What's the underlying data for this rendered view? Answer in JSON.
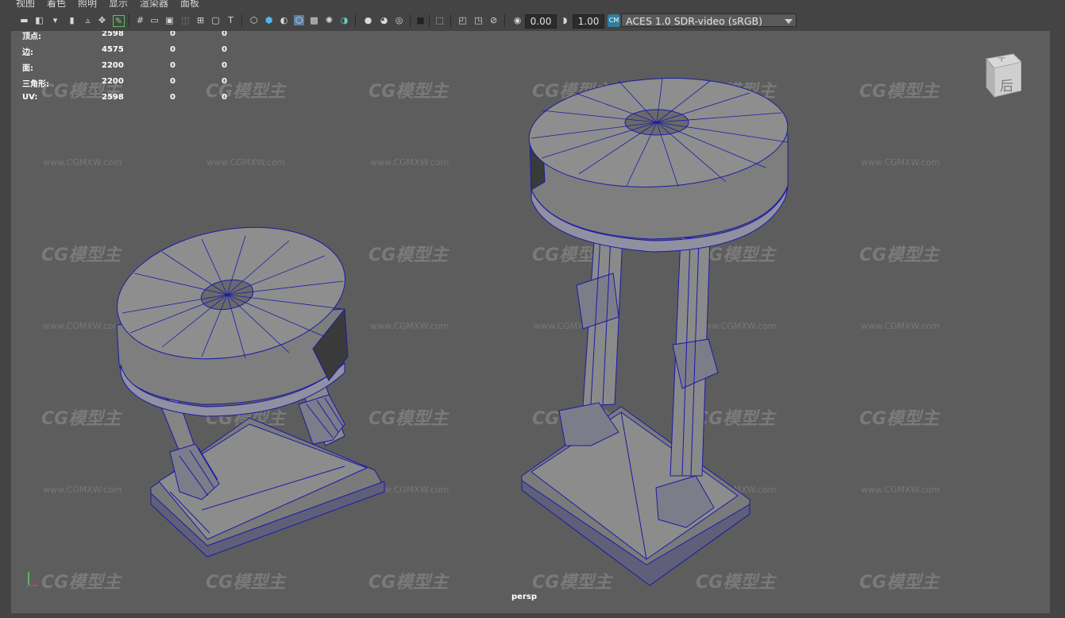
{
  "menu": [
    "视图",
    "着色",
    "照明",
    "显示",
    "渲染器",
    "面板"
  ],
  "toolbar": {
    "exposure_value": "0.00",
    "gamma_value": "1.00",
    "color_space": "ACES 1.0 SDR-video (sRGB)"
  },
  "hud": {
    "rows": [
      {
        "label": "顶点:",
        "v1": "2598",
        "v2": "0",
        "v3": "0"
      },
      {
        "label": "边:",
        "v1": "4575",
        "v2": "0",
        "v3": "0"
      },
      {
        "label": "面:",
        "v1": "2200",
        "v2": "0",
        "v3": "0"
      },
      {
        "label": "三角形:",
        "v1": "2200",
        "v2": "0",
        "v3": "0"
      },
      {
        "label": "UV:",
        "v1": "2598",
        "v2": "0",
        "v3": "0"
      }
    ]
  },
  "viewcube": {
    "top_face": "ㅜ",
    "front_face": "后"
  },
  "camera_label": "persp",
  "watermark": {
    "logo": "CG模型主",
    "url": "www.CGMXW.com"
  },
  "colors": {
    "wire": "#1a1aa8",
    "mesh": "#8a8a8a",
    "viewport_bg": "#5d5d5d"
  }
}
